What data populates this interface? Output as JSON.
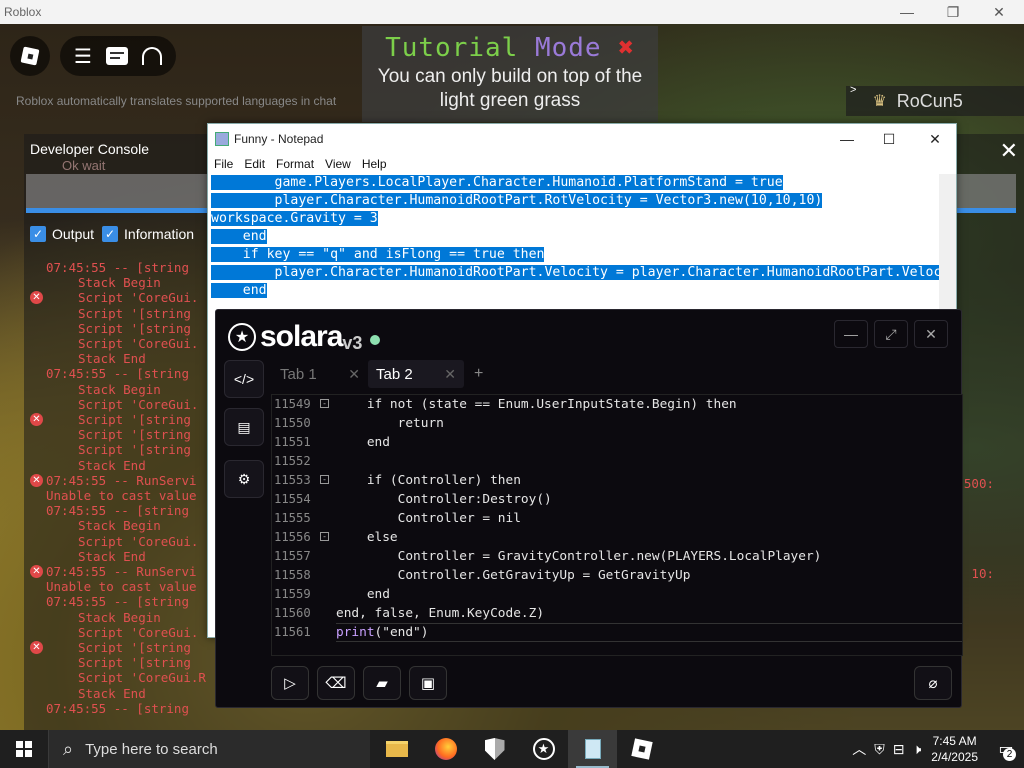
{
  "roblox": {
    "window_title": "Roblox",
    "tutorial_title_a": "Tutorial",
    "tutorial_title_b": "Mode",
    "tutorial_close": "✖",
    "tutorial_text": "You can only build on top of the light green grass",
    "auto_translate": "Roblox automatically translates supported languages in chat",
    "player_name": "RoCun5",
    "leaderboard_toggle": ">"
  },
  "devconsole": {
    "title": "Developer Console",
    "filter_output": "Output",
    "filter_information": "Information",
    "chat_faint": "Ok wait",
    "log": [
      {
        "text": "07:45:55 -- [string",
        "indent": false,
        "err": false
      },
      {
        "text": "Stack Begin",
        "indent": true,
        "err": false
      },
      {
        "text": "Script 'CoreGui.",
        "indent": true,
        "err": true
      },
      {
        "text": "Script '[string",
        "indent": true,
        "err": false
      },
      {
        "text": "Script '[string",
        "indent": true,
        "err": false
      },
      {
        "text": "Script 'CoreGui.",
        "indent": true,
        "err": false
      },
      {
        "text": "Stack End",
        "indent": true,
        "err": false
      },
      {
        "text": "07:45:55 -- [string",
        "indent": false,
        "err": false
      },
      {
        "text": "Stack Begin",
        "indent": true,
        "err": false
      },
      {
        "text": "Script 'CoreGui.",
        "indent": true,
        "err": false
      },
      {
        "text": "Script '[string",
        "indent": true,
        "err": true
      },
      {
        "text": "Script '[string",
        "indent": true,
        "err": false
      },
      {
        "text": "Script '[string",
        "indent": true,
        "err": false
      },
      {
        "text": "Stack End",
        "indent": true,
        "err": false
      },
      {
        "text": "07:45:55 -- RunServi",
        "indent": false,
        "err": true
      },
      {
        "text": "Unable to cast value",
        "indent": false,
        "err": false
      },
      {
        "text": "07:45:55 -- [string",
        "indent": false,
        "err": false
      },
      {
        "text": "Stack Begin",
        "indent": true,
        "err": false
      },
      {
        "text": "Script 'CoreGui.",
        "indent": true,
        "err": false
      },
      {
        "text": "Stack End",
        "indent": true,
        "err": false
      },
      {
        "text": "07:45:55 -- RunServi",
        "indent": false,
        "err": true
      },
      {
        "text": "Unable to cast value",
        "indent": false,
        "err": false
      },
      {
        "text": "07:45:55 -- [string",
        "indent": false,
        "err": false
      },
      {
        "text": "Stack Begin",
        "indent": true,
        "err": false
      },
      {
        "text": "Script 'CoreGui.",
        "indent": true,
        "err": false
      },
      {
        "text": "Script '[string",
        "indent": true,
        "err": true
      },
      {
        "text": "Script '[string",
        "indent": true,
        "err": false
      },
      {
        "text": "Script 'CoreGui.R",
        "indent": true,
        "err": false
      },
      {
        "text": "Stack End",
        "indent": true,
        "err": false
      },
      {
        "text": "07:45:55 -- [string",
        "indent": false,
        "err": false
      }
    ],
    "right_fragment_1": "500:",
    "right_fragment_2": "10:"
  },
  "notepad": {
    "title": "Funny - Notepad",
    "menu": [
      "File",
      "Edit",
      "Format",
      "View",
      "Help"
    ],
    "lines": [
      "        game.Players.LocalPlayer.Character.Humanoid.PlatformStand = true",
      "        player.Character.HumanoidRootPart.RotVelocity = Vector3.new(10,10,10)",
      "workspace.Gravity = 3",
      "    end",
      "",
      "    if key == \"q\" and isFlong == true then",
      "        player.Character.HumanoidRootPart.Velocity = player.Character.HumanoidRootPart.Veloc",
      "    end"
    ]
  },
  "solara": {
    "brand": "solara",
    "version": "v3",
    "tabs": [
      {
        "label": "Tab 1",
        "active": false
      },
      {
        "label": "Tab 2",
        "active": true
      }
    ],
    "add_tab": "+",
    "code": [
      {
        "n": "11549",
        "fold": "-",
        "t": "    if not (state == Enum.UserInputState.Begin) then"
      },
      {
        "n": "11550",
        "fold": "",
        "t": "        return"
      },
      {
        "n": "11551",
        "fold": "",
        "t": "    end"
      },
      {
        "n": "11552",
        "fold": "",
        "t": ""
      },
      {
        "n": "11553",
        "fold": "-",
        "t": "    if (Controller) then"
      },
      {
        "n": "11554",
        "fold": "",
        "t": "        Controller:Destroy()"
      },
      {
        "n": "11555",
        "fold": "",
        "t": "        Controller = nil"
      },
      {
        "n": "11556",
        "fold": "-",
        "t": "    else"
      },
      {
        "n": "11557",
        "fold": "",
        "t": "        Controller = GravityController.new(PLAYERS.LocalPlayer)"
      },
      {
        "n": "11558",
        "fold": "",
        "t": "        Controller.GetGravityUp = GetGravityUp"
      },
      {
        "n": "11559",
        "fold": "",
        "t": "    end"
      },
      {
        "n": "11560",
        "fold": "",
        "t": "end, false, Enum.KeyCode.Z)"
      },
      {
        "n": "11561",
        "fold": "",
        "t": "print(\"end\")"
      }
    ],
    "accent": "#8ee0b0"
  },
  "taskbar": {
    "search_placeholder": "Type here to search",
    "time": "7:45 AM",
    "date": "2/4/2025",
    "notifications": "2",
    "apps": [
      "file-explorer-icon",
      "firefox-icon",
      "shield-icon",
      "solara-icon",
      "notepad-icon",
      "roblox-icon"
    ]
  }
}
